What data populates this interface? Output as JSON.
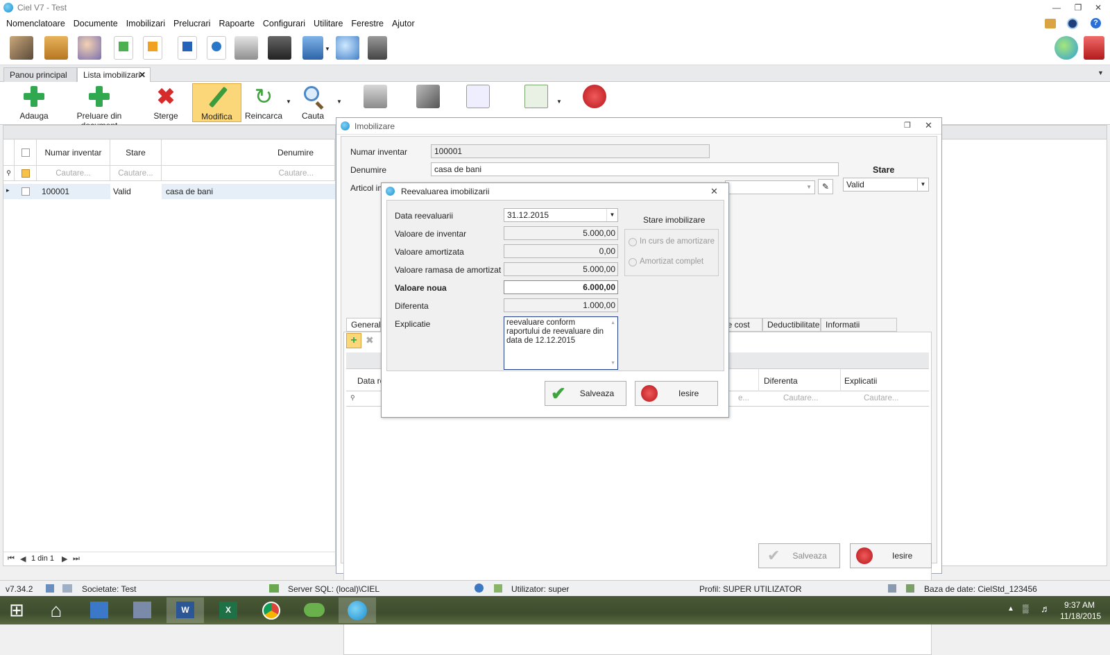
{
  "window": {
    "title": "Ciel V7 - Test"
  },
  "menu": [
    "Nomenclatoare",
    "Documente",
    "Imobilizari",
    "Prelucrari",
    "Rapoarte",
    "Configurari",
    "Utilitare",
    "Ferestre",
    "Ajutor"
  ],
  "tabs": {
    "main": "Panou principal",
    "list": "Lista imobilizari"
  },
  "ribbon": {
    "add": "Adauga",
    "from_doc": "Preluare din document",
    "delete": "Sterge",
    "modify": "Modifica",
    "reload": "Reincarca",
    "search": "Cauta"
  },
  "grid": {
    "col_inv": "Numar inventar",
    "col_state": "Stare",
    "col_name": "Denumire",
    "search_placeholder": "Cautare...",
    "rows": [
      {
        "inv": "100001",
        "state": "Valid",
        "name": "casa de bani"
      }
    ],
    "pager": "1 din 1"
  },
  "imob_dialog": {
    "title": "Imobilizare",
    "inv_label": "Numar inventar",
    "inv_value": "100001",
    "name_label": "Denumire",
    "name_value": "casa de bani",
    "article_label": "Articol imo",
    "state_label": "Stare",
    "state_value": "Valid",
    "tabs": {
      "general": "General",
      "cost": "le cost",
      "deduct": "Deductibilitate",
      "info": "Informatii aditionale"
    },
    "cols": {
      "date": "Data re",
      "diff": "Diferenta",
      "expl": "Explicatii"
    },
    "search_short": "e...",
    "save": "Salveaza",
    "exit": "Iesire"
  },
  "reev_dialog": {
    "title": "Reevaluarea imobilizarii",
    "date_label": "Data reevaluarii",
    "date_value": "31.12.2015",
    "inv_label": "Valoare de inventar",
    "inv_value": "5.000,00",
    "amort_label": "Valoare amortizata",
    "amort_value": "0,00",
    "remain_label": "Valoare ramasa de amortizat",
    "remain_value": "5.000,00",
    "new_label": "Valoare noua",
    "new_value": "6.000,00",
    "diff_label": "Diferenta",
    "diff_value": "1.000,00",
    "expl_label": "Explicatie",
    "expl_value": "reevaluare conform raportului de reevaluare din data de 12.12.2015",
    "state_group": "Stare imobilizare",
    "opt1": "In curs de amortizare",
    "opt2": "Amortizat complet",
    "save": "Salveaza",
    "exit": "Iesire"
  },
  "status": {
    "version": "v7.34.2",
    "company": "Societate: Test",
    "server": "Server SQL: (local)\\CIEL",
    "user": "Utilizator: super",
    "profile": "Profil: SUPER UTILIZATOR",
    "db": "Baza de date: CielStd_123456"
  },
  "clock": {
    "time": "9:37 AM",
    "date": "11/18/2015"
  }
}
